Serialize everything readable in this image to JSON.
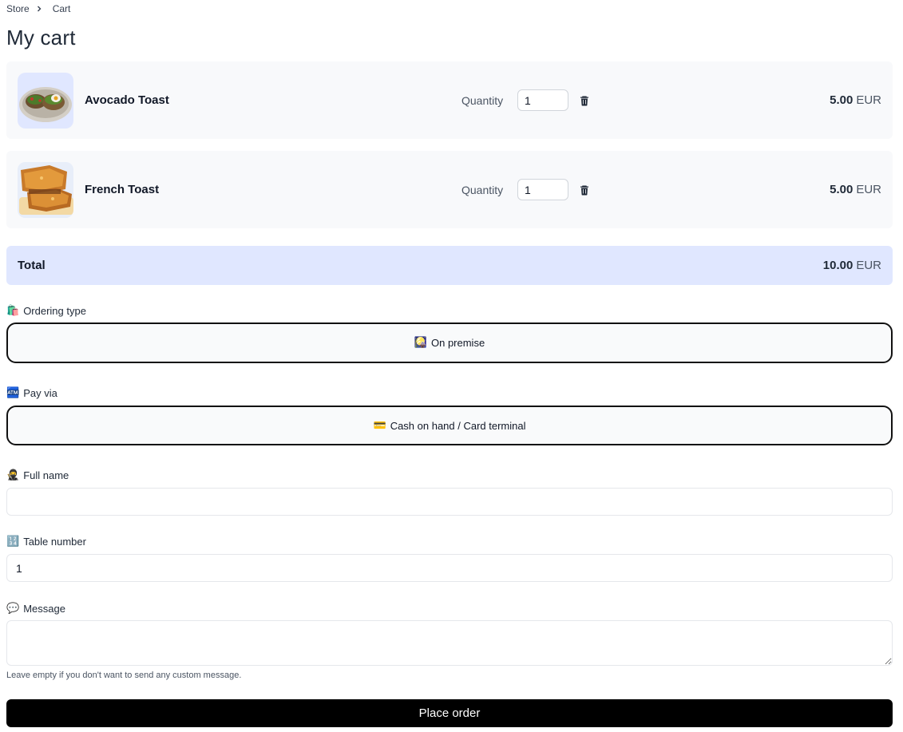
{
  "breadcrumb": {
    "store": "Store",
    "current": "Cart"
  },
  "page_title": "My cart",
  "items": [
    {
      "name": "Avocado Toast",
      "quantity_label": "Quantity",
      "quantity": "1",
      "price": "5.00",
      "currency": "EUR",
      "image": "avocado-toast-photo"
    },
    {
      "name": "French Toast",
      "quantity_label": "Quantity",
      "quantity": "1",
      "price": "5.00",
      "currency": "EUR",
      "image": "french-toast-photo"
    }
  ],
  "total": {
    "label": "Total",
    "amount": "10.00",
    "currency": "EUR"
  },
  "ordering_type": {
    "emoji": "🛍️",
    "label": "Ordering type",
    "value_emoji": "🎑",
    "value": "On premise"
  },
  "pay_via": {
    "emoji": "🏧",
    "label": "Pay via",
    "value_emoji": "💳",
    "value": "Cash on hand / Card terminal"
  },
  "full_name": {
    "emoji": "🥷",
    "label": "Full name",
    "value": ""
  },
  "table_number": {
    "emoji": "🔢",
    "label": "Table number",
    "value": "1"
  },
  "message": {
    "emoji": "💬",
    "label": "Message",
    "value": "",
    "hint": "Leave empty if you don't want to send any custom message."
  },
  "place_order_label": "Place order",
  "colors": {
    "total_bg": "#e0e7ff",
    "item_bg": "#f8f9fb",
    "button_bg": "#000000"
  }
}
